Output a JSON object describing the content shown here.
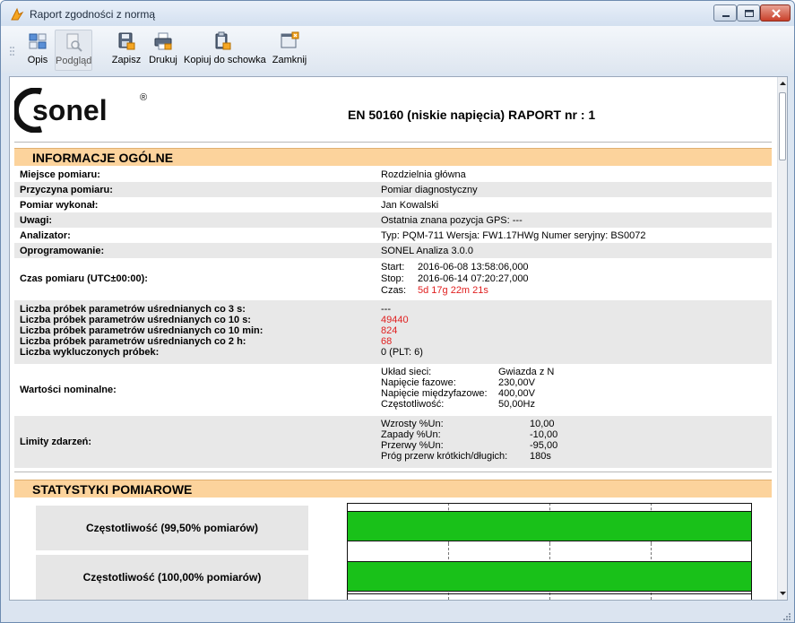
{
  "window": {
    "title": "Raport zgodności z normą"
  },
  "toolbar": {
    "opis": "Opis",
    "podglad": "Podgląd",
    "zapisz": "Zapisz",
    "drukuj": "Drukuj",
    "kopiuj": "Kopiuj do schowka",
    "zamknij": "Zamknij"
  },
  "report": {
    "logo": "sonel",
    "logo_reg": "®",
    "title": "EN 50160 (niskie napięcia) RAPORT nr : 1",
    "section_general": "INFORMACJE OGÓLNE",
    "section_stats": "STATYSTYKI POMIAROWE",
    "accent": "#fcd39c",
    "bar_color": "#19c119",
    "rows": {
      "miejsce_label": "Miejsce pomiaru:",
      "miejsce_value": "Rozdzielnia główna",
      "przyczyna_label": "Przyczyna pomiaru:",
      "przyczyna_value": "Pomiar diagnostyczny",
      "wykonal_label": "Pomiar wykonał:",
      "wykonal_value": "Jan Kowalski",
      "uwagi_label": "Uwagi:",
      "uwagi_value": "Ostatnia znana pozycja GPS: ---",
      "analizator_label": "Analizator:",
      "analizator_value": "Typ: PQM-711 Wersja: FW1.17HWg Numer seryjny: BS0072",
      "oprog_label": "Oprogramowanie:",
      "oprog_value": "SONEL Analiza 3.0.0",
      "czas_label": "Czas pomiaru (UTC±00:00):",
      "start_label": "Start:",
      "start_value": "2016-06-08 13:58:06,000",
      "stop_label": "Stop:",
      "stop_value": "2016-06-14 07:20:27,000",
      "czas_sub_label": "Czas:",
      "czas_sub_value": "5d 17g 22m 21s"
    },
    "samples": {
      "l1": "Liczba próbek parametrów uśrednianych co 3 s:",
      "v1": "---",
      "l2": "Liczba próbek parametrów uśrednianych co 10 s:",
      "v2": "49440",
      "l3": "Liczba próbek parametrów uśrednianych co 10 min:",
      "v3": "824",
      "l4": "Liczba próbek parametrów uśrednianych co 2 h:",
      "v4": "68",
      "l5": "Liczba wykluczonych próbek:",
      "v5": "0 (PLT: 6)"
    },
    "nominal": {
      "label": "Wartości nominalne:",
      "k1": "Układ sieci:",
      "v1": "Gwiazda z N",
      "k2": "Napięcie fazowe:",
      "v2": "230,00V",
      "k3": "Napięcie międzyfazowe:",
      "v3": "400,00V",
      "k4": "Częstotliwość:",
      "v4": "50,00Hz"
    },
    "limits": {
      "label": "Limity zdarzeń:",
      "k1": "Wzrosty %Un:",
      "v1": "10,00",
      "k2": "Zapady %Un:",
      "v2": "-10,00",
      "k3": "Przerwy %Un:",
      "v3": "-95,00",
      "k4": "Próg przerw krótkich/długich:",
      "v4": "180s"
    },
    "stats": [
      {
        "label": "Częstotliwość (99,50% pomiarów)",
        "fill": 1.0
      },
      {
        "label": "Częstotliwość (100,00% pomiarów)",
        "fill": 1.0
      }
    ]
  }
}
